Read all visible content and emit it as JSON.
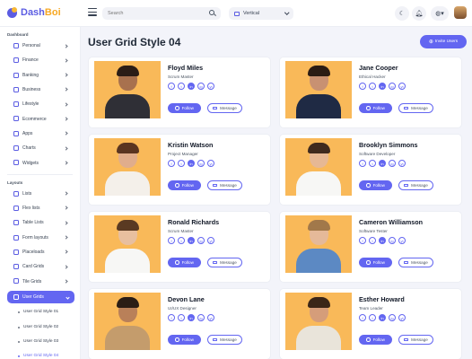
{
  "brand": {
    "name_main": "Dash",
    "name_accent": "Boi"
  },
  "header": {
    "search_placeholder": "Search",
    "layout_value": "Vertical",
    "theme_icon": "moon-icon",
    "notification_icon": "bell-icon",
    "language_icon": "globe-icon"
  },
  "sidebar": {
    "dashboard_heading": "Dashboard",
    "dashboard_items": [
      {
        "label": "Personal",
        "icon": "user-icon"
      },
      {
        "label": "Finance",
        "icon": "finance-icon"
      },
      {
        "label": "Banking",
        "icon": "bank-icon"
      },
      {
        "label": "Business",
        "icon": "briefcase-icon"
      },
      {
        "label": "Lifestyle",
        "icon": "heart-icon"
      },
      {
        "label": "Ecommerce",
        "icon": "cart-icon"
      },
      {
        "label": "Apps",
        "icon": "apps-icon"
      },
      {
        "label": "Charts",
        "icon": "chart-icon"
      },
      {
        "label": "Widgets",
        "icon": "widget-icon"
      }
    ],
    "layouts_heading": "Layouts",
    "layout_items": [
      {
        "label": "Lists",
        "icon": "list-icon"
      },
      {
        "label": "Flex lists",
        "icon": "flex-list-icon"
      },
      {
        "label": "Table Lists",
        "icon": "table-icon"
      },
      {
        "label": "Form layouts",
        "icon": "form-icon"
      },
      {
        "label": "Placeloads",
        "icon": "placeload-icon"
      },
      {
        "label": "Card Grids",
        "icon": "card-grid-icon"
      },
      {
        "label": "Tile Grids",
        "icon": "tile-grid-icon"
      }
    ],
    "active_item": {
      "label": "User Grids",
      "icon": "user-grid-icon"
    },
    "sub_items": [
      "User Grid Style 01",
      "User Grid Style 02",
      "User Grid Style 03",
      "User Grid Style 04"
    ]
  },
  "page": {
    "title": "User Grid Style 04",
    "invite_label": "Invite Users"
  },
  "actions": {
    "follow_label": "Follow",
    "message_label": "Message"
  },
  "socials": [
    "f",
    "t",
    "in",
    "ig",
    "yt"
  ],
  "users": [
    {
      "name": "Floyd Miles",
      "role": "Scrum Master",
      "colors": {
        "skin": "#a8714e",
        "hair": "#2b1d16",
        "shirt": "#2f2f36"
      }
    },
    {
      "name": "Jane Cooper",
      "role": "Ethical Hacker",
      "colors": {
        "skin": "#c89172",
        "hair": "#2a1c14",
        "shirt": "#1f2a44"
      }
    },
    {
      "name": "Kristin Watson",
      "role": "Project Manager",
      "colors": {
        "skin": "#e0ad8c",
        "hair": "#5a3521",
        "shirt": "#f4f0ea"
      }
    },
    {
      "name": "Brooklyn Simmons",
      "role": "Software Developer",
      "colors": {
        "skin": "#e6b894",
        "hair": "#3f2a1e",
        "shirt": "#f7f7f5"
      }
    },
    {
      "name": "Ronald Richards",
      "role": "Scrum Master",
      "colors": {
        "skin": "#e8bf9f",
        "hair": "#5a3a22",
        "shirt": "#f7f7f5"
      }
    },
    {
      "name": "Cameron Williamson",
      "role": "Software Tester",
      "colors": {
        "skin": "#e5b999",
        "hair": "#a1784a",
        "shirt": "#5c89c3"
      }
    },
    {
      "name": "Devon Lane",
      "role": "UI/UX Designer",
      "colors": {
        "skin": "#b98059",
        "hair": "#2a1d15",
        "shirt": "#c49c6c"
      }
    },
    {
      "name": "Esther Howard",
      "role": "Team Leader",
      "colors": {
        "skin": "#d59d7a",
        "hair": "#3a2618",
        "shirt": "#e9e4da"
      }
    }
  ],
  "colors": {
    "accent": "#6366f1",
    "photo_bg": "#f9b959",
    "page_bg": "#f3f4fa"
  }
}
